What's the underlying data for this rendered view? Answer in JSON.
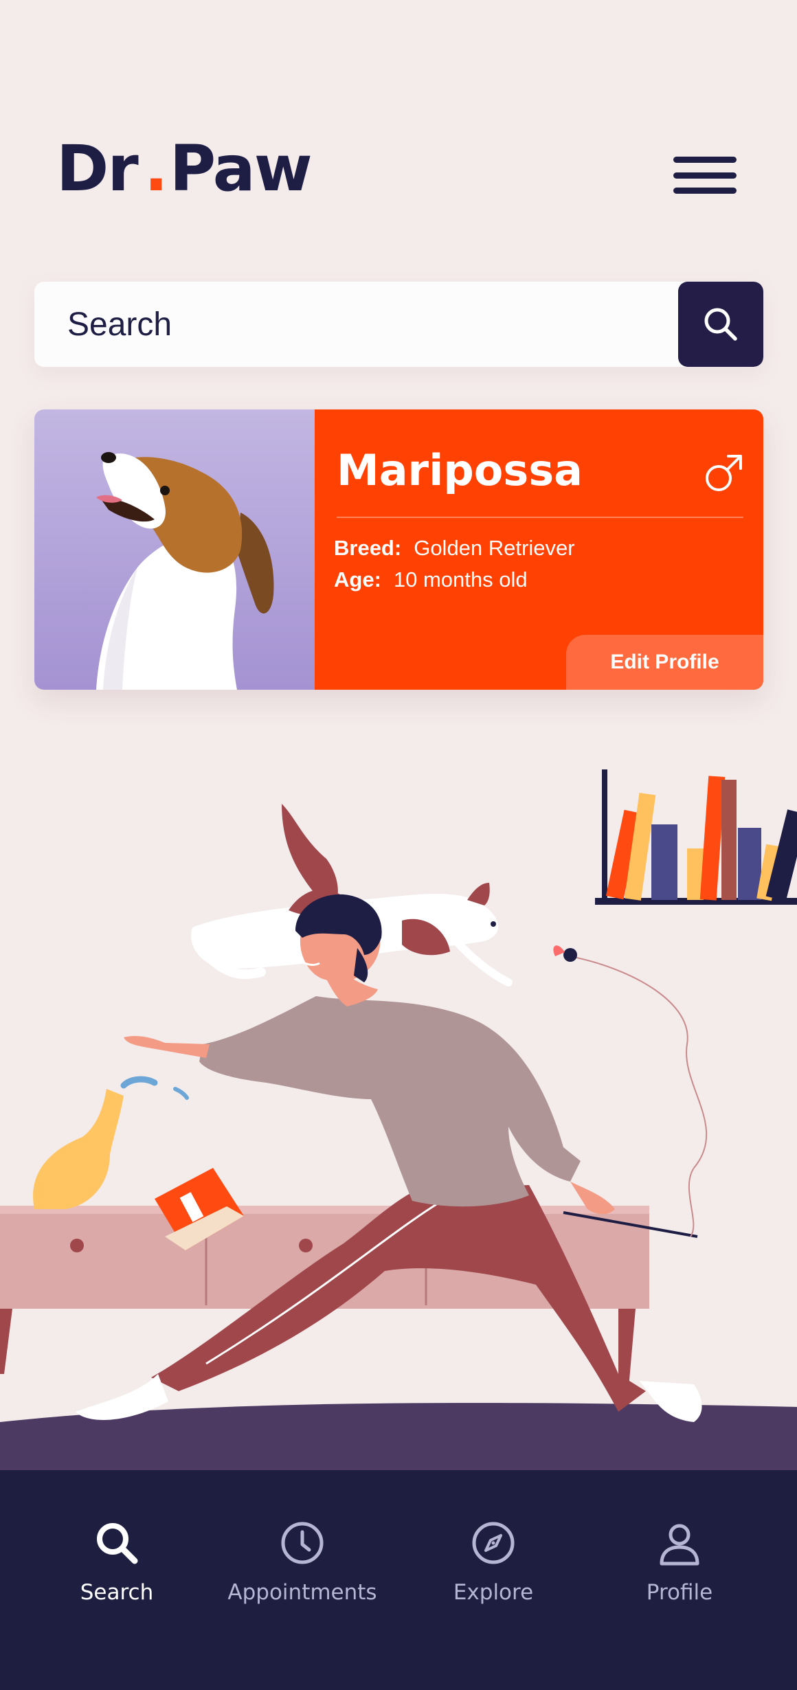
{
  "header": {
    "logo_left": "Dr",
    "logo_dot": ".",
    "logo_right": "Paw"
  },
  "search": {
    "placeholder": "Search",
    "button_icon": "search-icon"
  },
  "pet": {
    "name": "Maripossa",
    "gender_icon": "male-symbol-icon",
    "breed_label": "Breed:",
    "breed_value": "Golden Retriever",
    "age_label": "Age:",
    "age_value": "10 months old",
    "edit_label": "Edit Profile"
  },
  "nav": {
    "items": [
      {
        "label": "Search",
        "icon": "search-icon",
        "active": true
      },
      {
        "label": "Appointments",
        "icon": "clock-icon",
        "active": false
      },
      {
        "label": "Explore",
        "icon": "compass-icon",
        "active": false
      },
      {
        "label": "Profile",
        "icon": "person-icon",
        "active": false
      }
    ]
  },
  "colors": {
    "navy": "#1e1e45",
    "accent_orange": "#ff4103",
    "background": "#f4ebeb",
    "photo_purple": "#b3a5db"
  }
}
